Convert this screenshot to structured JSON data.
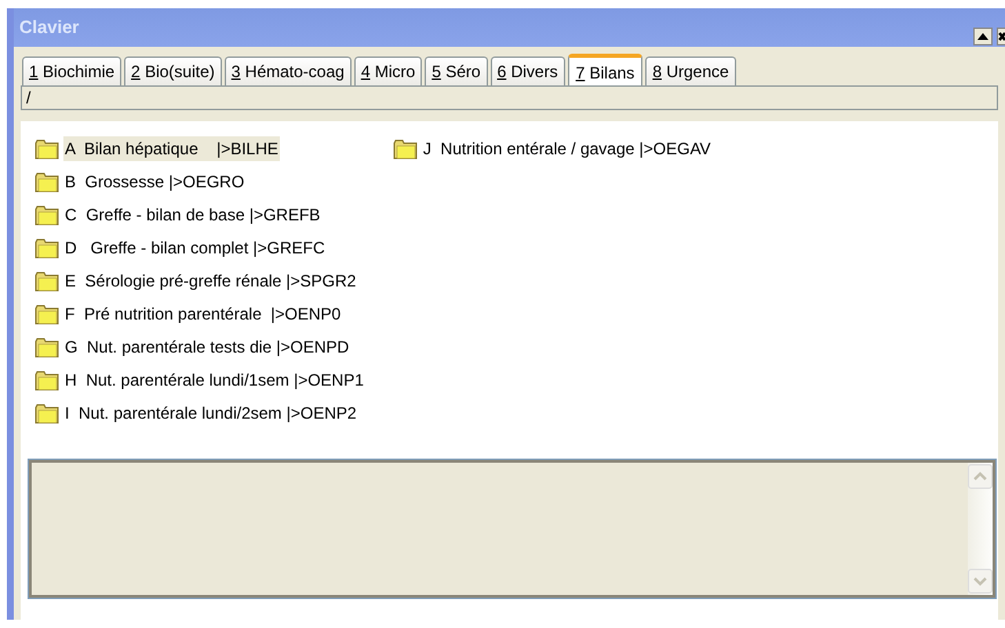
{
  "window": {
    "title": "Clavier"
  },
  "tabs": [
    {
      "label": "1 Biochimie",
      "selected": false
    },
    {
      "label": "2 Bio(suite)",
      "selected": false
    },
    {
      "label": "3 Hémato-coag",
      "selected": false
    },
    {
      "label": "4 Micro",
      "selected": false
    },
    {
      "label": "5 Séro",
      "selected": false
    },
    {
      "label": "6 Divers",
      "selected": false
    },
    {
      "label": "7 Bilans",
      "selected": true
    },
    {
      "label": "8 Urgence",
      "selected": false
    }
  ],
  "path": {
    "value": "/"
  },
  "items": [
    {
      "label": "A  Bilan hépatique    |>BILHE",
      "selected": true
    },
    {
      "label": "B  Grossesse |>OEGRO",
      "selected": false
    },
    {
      "label": "C  Greffe - bilan de base |>GREFB",
      "selected": false
    },
    {
      "label": "D   Greffe - bilan complet |>GREFC",
      "selected": false
    },
    {
      "label": "E  Sérologie pré-greffe rénale |>SPGR2",
      "selected": false
    },
    {
      "label": "F  Pré nutrition parentérale  |>OENP0",
      "selected": false
    },
    {
      "label": "G  Nut. parentérale tests die |>OENPD",
      "selected": false
    },
    {
      "label": "H  Nut. parentérale lundi/1sem |>OENP1",
      "selected": false
    },
    {
      "label": "I  Nut. parentérale lundi/2sem |>OENP2",
      "selected": false
    },
    {
      "label": "J  Nutrition entérale / gavage |>OEGAV",
      "selected": false
    }
  ]
}
